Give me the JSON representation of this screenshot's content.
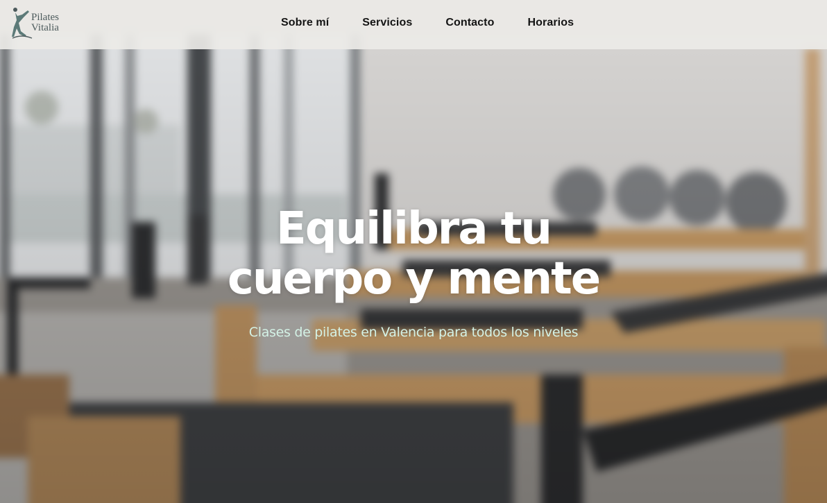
{
  "brand": {
    "logo_icon": "pilates-figure-icon",
    "name_line1": "Pilates",
    "name_line2": "Vitalia"
  },
  "nav": {
    "items": [
      {
        "label": "Sobre mí"
      },
      {
        "label": "Servicios"
      },
      {
        "label": "Contacto"
      },
      {
        "label": "Horarios"
      }
    ]
  },
  "hero": {
    "title_line1": "Equilibra tu",
    "title_line2": "cuerpo y mente",
    "subtitle": "Clases de pilates en Valencia para todos los niveles",
    "subtitle_color": "#d4f2e6"
  },
  "colors": {
    "header_bg": "#eceae7",
    "nav_text": "#141414",
    "logo": "#4c5a5c"
  }
}
